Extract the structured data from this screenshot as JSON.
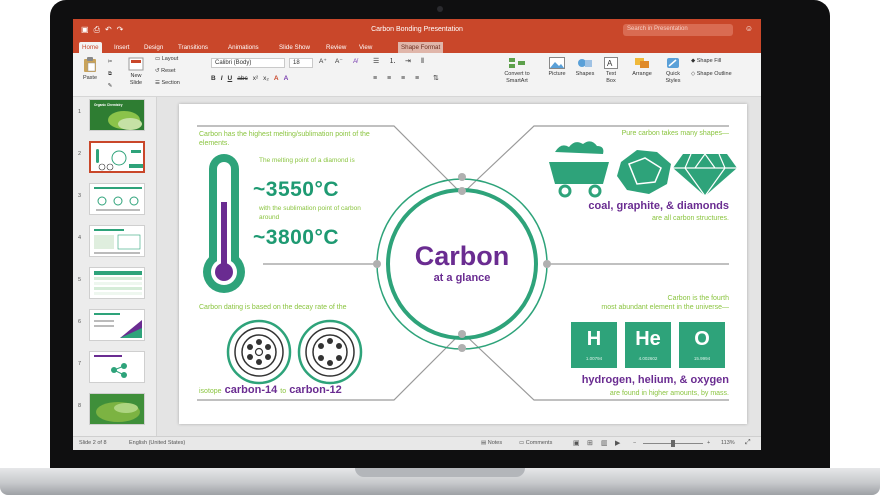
{
  "window": {
    "title": "Carbon Bonding Presentation",
    "search_placeholder": "Search in Presentation"
  },
  "ribbon_tabs": [
    "Home",
    "Insert",
    "Design",
    "Transitions",
    "Animations",
    "Slide Show",
    "Review",
    "View",
    "Shape Format"
  ],
  "ribbon": {
    "paste": "Paste",
    "new_slide": "New\nSlide",
    "layout": "Layout",
    "reset": "Reset",
    "section": "Section",
    "font": "Calibri (Body)",
    "size": "18",
    "convert": "Convert to\nSmartArt",
    "picture": "Picture",
    "shapes": "Shapes",
    "textbox": "Text\nBox",
    "arrange": "Arrange",
    "quick_styles": "Quick\nStyles",
    "shape_fill": "Shape Fill",
    "shape_outline": "Shape Outline"
  },
  "thumbnails": [
    "1",
    "2",
    "3",
    "4",
    "5",
    "6",
    "7",
    "8"
  ],
  "thumb1_title": "Organic Chemistry",
  "slide": {
    "center_title": "Carbon",
    "center_sub": "at a glance",
    "tl_heading": "Carbon has the highest melting/sublimation point of the elements.",
    "tl_melt_label": "The melting point of a diamond is",
    "tl_melt_value": "~3550°C",
    "tl_sub_label": "with the sublimation point of carbon around",
    "tl_sub_value": "~3800°C",
    "tr_heading": "Pure carbon takes many shapes—",
    "tr_forms": "coal, graphite, & diamonds",
    "tr_caption": "are all carbon structures.",
    "bl_heading": "Carbon dating is based on the decay rate of the",
    "bl_prefix": "isotope",
    "bl_c14": "carbon-14",
    "bl_to": "to",
    "bl_c12": "carbon-12",
    "br_heading_1": "Carbon is the fourth",
    "br_heading_2": "most abundant element in the universe—",
    "elements": [
      {
        "symbol": "H",
        "weight": "1.00794"
      },
      {
        "symbol": "He",
        "weight": "4.002602"
      },
      {
        "symbol": "O",
        "weight": "15.9994"
      }
    ],
    "br_elements": "hydrogen, helium, & oxygen",
    "br_caption": "are found in higher amounts, by mass."
  },
  "status": {
    "slide_of": "Slide 2 of 8",
    "language": "English (United States)",
    "notes": "Notes",
    "comments": "Comments",
    "zoom": "113%"
  },
  "colors": {
    "ribbon_red": "#c9472a",
    "green": "#8ac43f",
    "teal": "#1e9a72",
    "purple": "#6a2c91"
  }
}
